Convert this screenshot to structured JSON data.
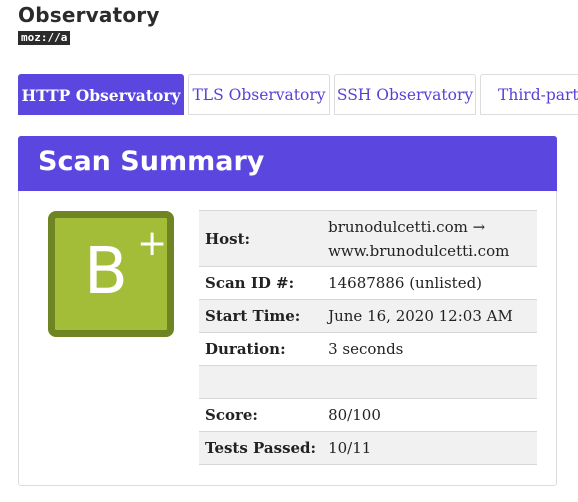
{
  "brand": {
    "title": "Observatory",
    "logo": "moz://a"
  },
  "tabs": [
    {
      "label": "HTTP Observatory",
      "active": true
    },
    {
      "label": "TLS Observatory",
      "active": false
    },
    {
      "label": "SSH Observatory",
      "active": false
    },
    {
      "label": "Third-party V",
      "active": false
    }
  ],
  "panel": {
    "title": "Scan Summary",
    "grade": {
      "letter": "B",
      "modifier": "+"
    },
    "rows": [
      {
        "key": "Host:",
        "value_line1": "brunodulcetti.com →",
        "value_line2": "www.brunodulcetti.com"
      },
      {
        "key": "Scan ID #:",
        "value": "14687886 (unlisted)"
      },
      {
        "key": "Start Time:",
        "value": "June 16, 2020 12:03 AM"
      },
      {
        "key": "Duration:",
        "value": "3 seconds"
      },
      {
        "key": "",
        "value": ""
      },
      {
        "key": "Score:",
        "value": "80/100"
      },
      {
        "key": "Tests Passed:",
        "value": "10/11"
      }
    ]
  },
  "colors": {
    "accent": "#5b46e0",
    "grade_fill": "#a3bd39",
    "grade_border": "#6f8423",
    "row_alt": "#f1f1f1"
  }
}
